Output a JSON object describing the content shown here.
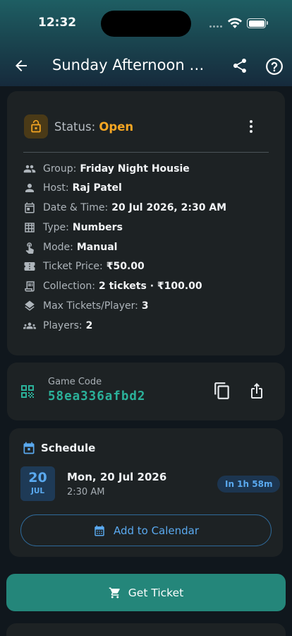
{
  "status_bar": {
    "time": "12:32"
  },
  "header": {
    "title": "Sunday Afternoon Ta..."
  },
  "game": {
    "status_label": "Status:",
    "status_value": "Open",
    "rows": [
      {
        "icon": "group-icon",
        "label": "Group:",
        "value": "Friday Night Housie"
      },
      {
        "icon": "person-icon",
        "label": "Host:",
        "value": "Raj Patel"
      },
      {
        "icon": "calendar-icon",
        "label": "Date & Time:",
        "value": "20 Jul 2026, 2:30 AM"
      },
      {
        "icon": "grid-icon",
        "label": "Type:",
        "value": "Numbers"
      },
      {
        "icon": "touch-icon",
        "label": "Mode:",
        "value": "Manual"
      },
      {
        "icon": "ticket-icon",
        "label": "Ticket Price:",
        "value": "₹50.00"
      },
      {
        "icon": "receipt-icon",
        "label": "Collection:",
        "value": "2 tickets · ₹100.00"
      },
      {
        "icon": "layers-icon",
        "label": "Max Tickets/Player:",
        "value": "3"
      },
      {
        "icon": "players-icon",
        "label": "Players:",
        "value": "2"
      }
    ]
  },
  "game_code": {
    "label": "Game Code",
    "value": "58ea336afbd2"
  },
  "schedule": {
    "title": "Schedule",
    "day": "20",
    "month": "JUL",
    "date_text": "Mon, 20 Jul 2026",
    "time_text": "2:30 AM",
    "eta": "In 1h 58m",
    "calendar_button": "Add to Calendar"
  },
  "actions": {
    "get_ticket": "Get Ticket"
  },
  "colors": {
    "accent": "#24867a",
    "open": "#f5a623",
    "code": "#2bb19a",
    "blue": "#5aa9ef"
  }
}
